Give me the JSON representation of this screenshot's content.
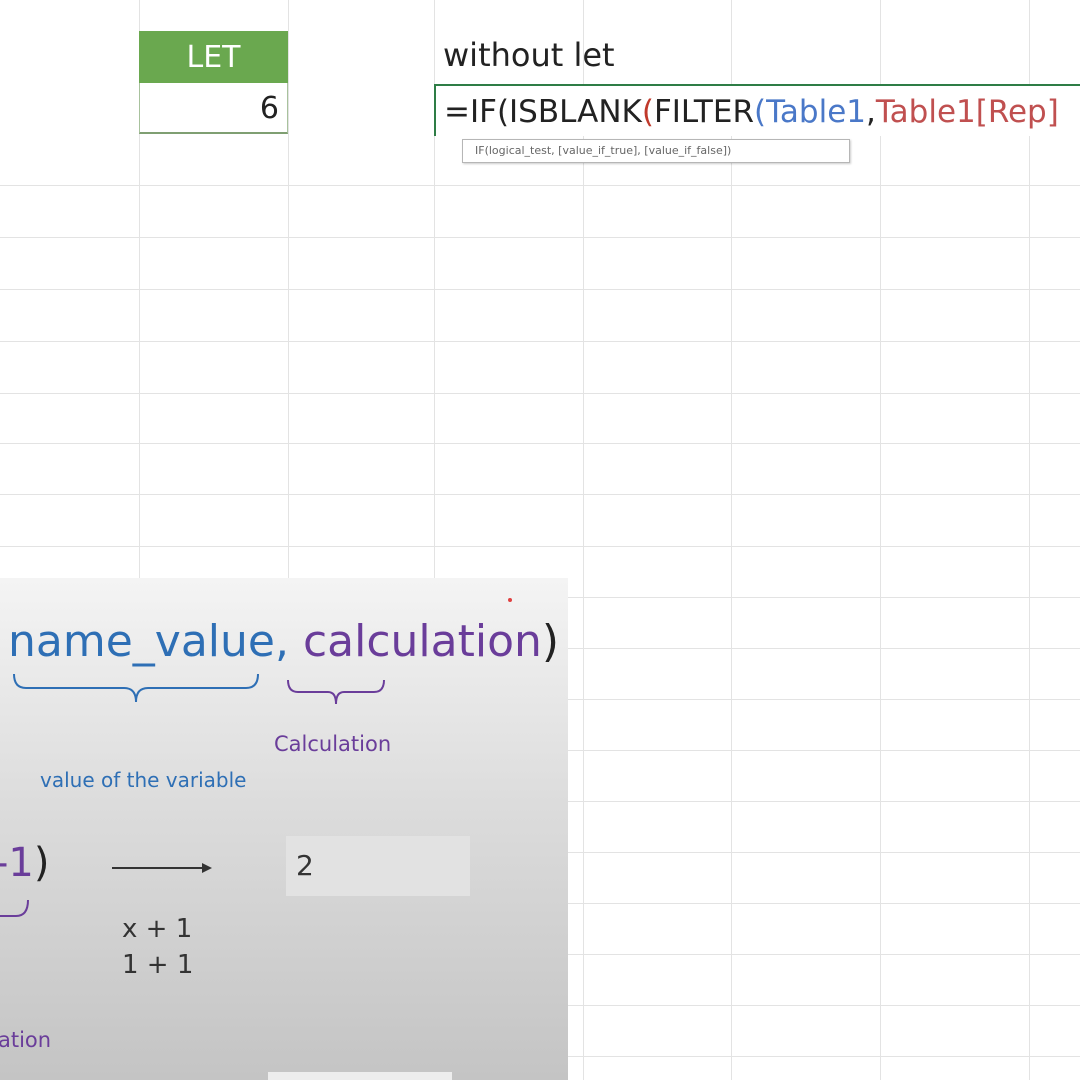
{
  "sheet": {
    "let_header": "LET",
    "let_value": "6",
    "without_let_label": "without let",
    "formula": {
      "part1": "=IF(ISBLANK",
      "part2": "(",
      "part3": "FILTER",
      "part4": "(",
      "part5": "Table1",
      "part6": ",",
      "part7": "Table1[Rep]"
    },
    "tooltip": "IF(logical_test, [value_if_true], [value_if_false])"
  },
  "slide": {
    "syntax_name_value": "name_value,",
    "syntax_calculation": "calculation",
    "syntax_close": ")",
    "value_caption": "value of the variable",
    "calc_caption": "Calculation",
    "example_tail_num": "-1",
    "example_tail_paren": ")",
    "result_value": "2",
    "step1": "x + 1",
    "step2": "1 + 1",
    "bottom_caption": "ation"
  },
  "colors": {
    "header_green": "#6aa84f",
    "formula_blue": "#4a78c8",
    "formula_red": "#c05050",
    "slide_blue": "#2e6fb5",
    "slide_purple": "#6a3d9a"
  }
}
